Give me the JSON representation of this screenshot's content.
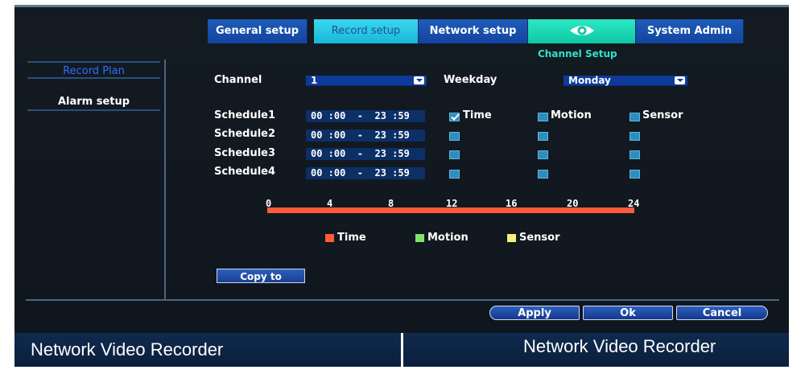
{
  "tabs": [
    {
      "label": "General setup"
    },
    {
      "label": "Record setup"
    },
    {
      "label": "Network setup"
    },
    {
      "label": ""
    },
    {
      "label": "System Admin"
    }
  ],
  "channel_setup_label": "Channel Setup",
  "sidebar": {
    "items": [
      {
        "label": "Record Plan",
        "active": true
      },
      {
        "label": "Alarm setup",
        "active": false
      }
    ]
  },
  "form": {
    "channel_label": "Channel",
    "channel_value": "1",
    "weekday_label": "Weekday",
    "weekday_value": "Monday"
  },
  "schedules": [
    {
      "label": "Schedule1",
      "time": "00 :00  -  23 :59",
      "time_checked": true,
      "motion_checked": false,
      "sensor_checked": false
    },
    {
      "label": "Schedule2",
      "time": "00 :00  -  23 :59",
      "time_checked": false,
      "motion_checked": false,
      "sensor_checked": false
    },
    {
      "label": "Schedule3",
      "time": "00 :00  -  23 :59",
      "time_checked": false,
      "motion_checked": false,
      "sensor_checked": false
    },
    {
      "label": "Schedule4",
      "time": "00 :00  -  23 :59",
      "time_checked": false,
      "motion_checked": false,
      "sensor_checked": false
    }
  ],
  "column_labels": {
    "time": "Time",
    "motion": "Motion",
    "sensor": "Sensor"
  },
  "timeline": {
    "ticks": [
      "0",
      "4",
      "8",
      "12",
      "16",
      "20",
      "24"
    ],
    "bar_color": "#ff5b3b"
  },
  "legend": [
    {
      "label": "Time",
      "color": "#ff5b3b"
    },
    {
      "label": "Motion",
      "color": "#7ee36a"
    },
    {
      "label": "Sensor",
      "color": "#f6f07a"
    }
  ],
  "buttons": {
    "copy_to": "Copy to",
    "apply": "Apply",
    "ok": "Ok",
    "cancel": "Cancel"
  },
  "footer": {
    "left": "Network Video Recorder",
    "right": "Network Video Recorder"
  }
}
